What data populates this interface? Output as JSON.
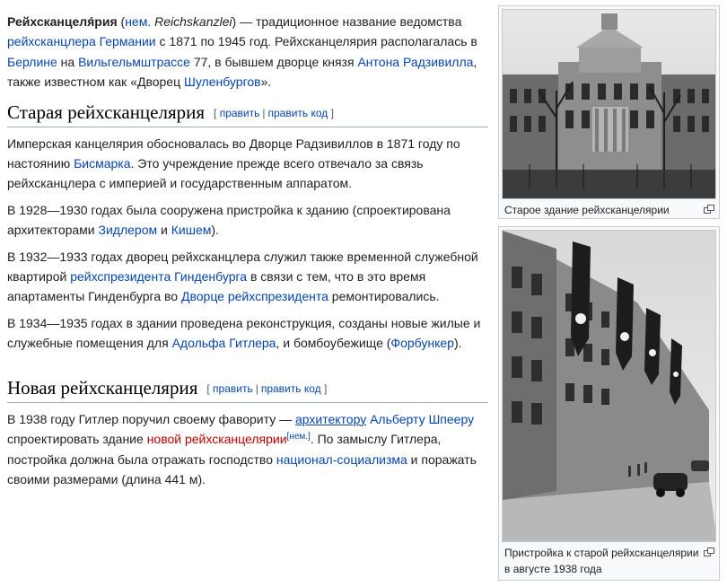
{
  "intro": {
    "bold": "Рейхсканцеля́рия",
    "open_paren": " (",
    "lang": "нем.",
    "term": "Reichskanzlei",
    "t1": ") — традиционное название ведомства ",
    "l_chancellor": "рейхсканцлера Германии",
    "t2": " с 1871 по 1945 год. Рейхсканцелярия располагалась в ",
    "l_berlin": "Берлине",
    "t3": " на ",
    "l_street": "Вильгельмштрассе",
    "t4": " 77, в бывшем дворце князя ",
    "l_anton": "Антона Радзивилла",
    "t5": ", также известном как «Дворец ",
    "l_schulenburg": "Шуленбургов",
    "t6": "»."
  },
  "old": {
    "heading": "Старая рейхсканцелярия",
    "edit_open": "[ ",
    "edit": "править",
    "edit_sep": "|",
    "edit_code": "править код",
    "edit_close": " ]",
    "p1_t1": "Имперская канцелярия обосновалась во Дворце Радзивиллов в 1871 году по настоянию ",
    "p1_l1": "Бисмарка",
    "p1_t2": ". Это учреждение прежде всего отвечало за связь рейхсканцлера с империей и государственным аппаратом.",
    "p2_t1": "В 1928—1930 годах была сооружена пристройка к зданию (спроектирована архитекторами ",
    "p2_l1": "Зидлером",
    "p2_t2": " и ",
    "p2_l2": "Кишем",
    "p2_t3": ").",
    "p3_t1": "В 1932—1933 годах дворец рейхсканцлера служил также временной служебной квартирой ",
    "p3_l1": "рейхспрезидента Гинденбурга",
    "p3_t2": " в связи с тем, что в это время апартаменты Гинденбурга во ",
    "p3_l2": "Дворце рейхспрезидента",
    "p3_t3": " ремонтировались.",
    "p4_t1": "В 1934—1935 годах в здании проведена реконструкция, созданы новые жилые и служебные помещения для ",
    "p4_l1": "Адольфа Гитлера",
    "p4_t2": ", и бомбоубежище (",
    "p4_l2": "Форбункер",
    "p4_t3": ")."
  },
  "new": {
    "heading": "Новая рейхсканцелярия",
    "edit_open": "[ ",
    "edit": "править",
    "edit_sep": "|",
    "edit_code": "править код",
    "edit_close": " ]",
    "t1": "В 1938 году Гитлер поручил своему фавориту — ",
    "l_arch": "архитектору",
    "t_sp": " ",
    "l_speer": "Альберту Шпееру",
    "t2": " спроектировать здание ",
    "l_new": "новой рейхсканцелярии",
    "sup": "[нем.]",
    "t3": ". По замыслу Гитлера, постройка должна была отражать господство ",
    "l_ns": "национал-социализма",
    "t4": " и поражать своими размерами (длина 441 м)."
  },
  "figures": [
    {
      "caption": "Старое здание рейхсканцелярии",
      "icon": "magnify-icon"
    },
    {
      "caption": "Пристройка к старой рейхсканцелярии в августе 1938 года",
      "icon": "magnify-icon"
    }
  ],
  "colors": {
    "link": "#0645ad",
    "redlink": "#ba0000",
    "text": "#202122",
    "border": "#a2a9b1"
  }
}
